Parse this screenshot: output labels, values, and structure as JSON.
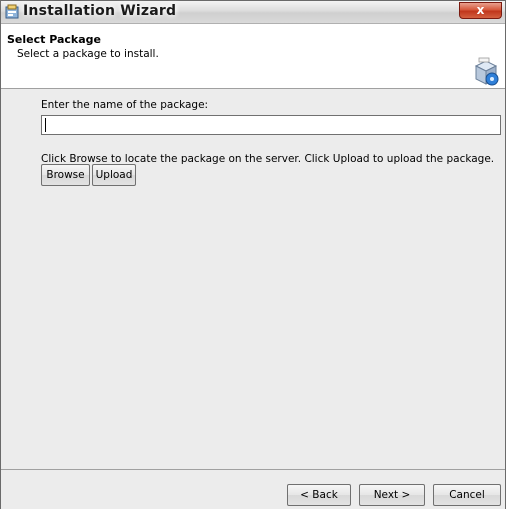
{
  "window": {
    "title": "Installation Wizard",
    "close_label": "x"
  },
  "header": {
    "title": "Select Package",
    "subtitle": "Select a package to install."
  },
  "content": {
    "name_label": "Enter the name of the package:",
    "name_value": "",
    "browse_instruction": "Click Browse to locate the package on the server. Click Upload to upload the package.",
    "browse_label": "Browse",
    "upload_label": "Upload"
  },
  "footer": {
    "back_label": "< Back",
    "next_label": "Next >",
    "cancel_label": "Cancel"
  },
  "icons": {
    "title": "installer-icon",
    "header": "package-box-icon"
  },
  "colors": {
    "close_button": "#c8432a",
    "dialog_background": "#ececec",
    "header_background": "#ffffff"
  }
}
